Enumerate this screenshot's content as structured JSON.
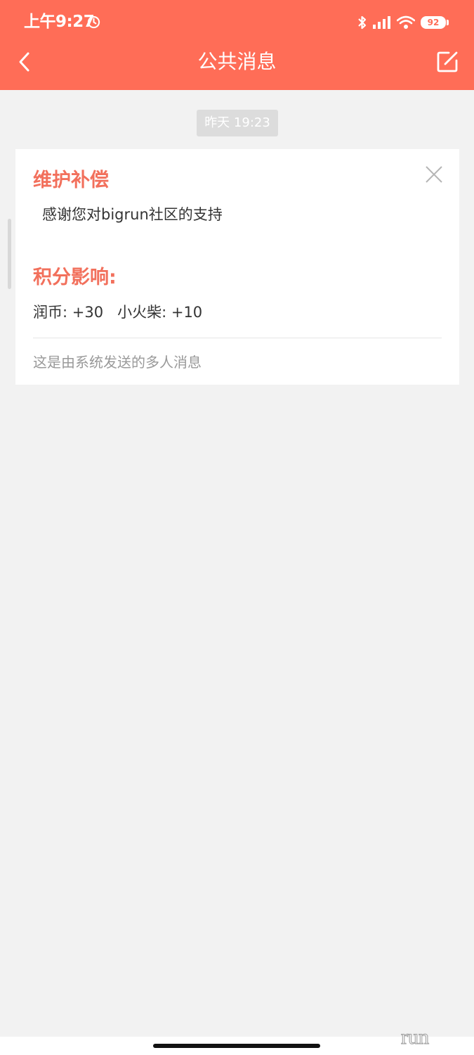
{
  "status_bar": {
    "time": "上午9:27",
    "battery": "92",
    "icons": [
      "alarm-clock-icon",
      "bluetooth-icon",
      "cellular-signal-icon",
      "wifi-icon",
      "battery-icon"
    ]
  },
  "header": {
    "title": "公共消息",
    "back_icon": "chevron-left-icon",
    "compose_icon": "edit-icon"
  },
  "timestamp": "昨天 19:23",
  "message": {
    "title": "维护补偿",
    "body": "感谢您对bigrun社区的支持",
    "points_heading": "积分影响:",
    "points_line": "润币: +30   小火柴: +10",
    "footer": "这是由系统发送的多人消息",
    "close_icon": "close-icon"
  },
  "colors": {
    "header_bg": "#ff6d57",
    "accent_text": "#f2705c",
    "page_bg": "#f2f2f2"
  },
  "watermark": "run"
}
